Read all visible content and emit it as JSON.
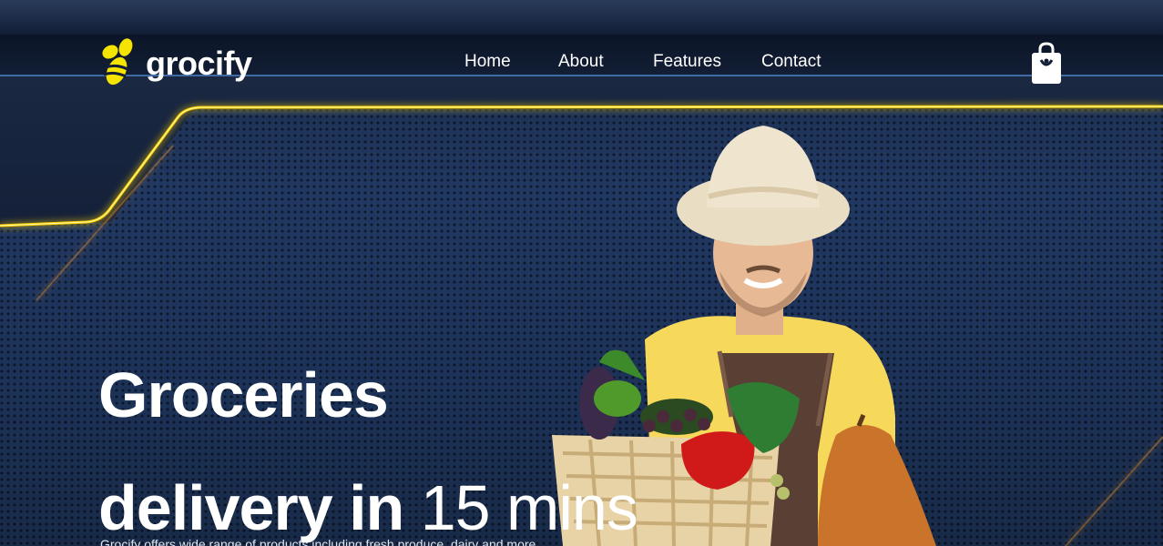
{
  "brand": {
    "name": "grocify",
    "logo_icon": "bee-icon",
    "accent_color": "#f5e400"
  },
  "nav": {
    "items": [
      {
        "label": "Home"
      },
      {
        "label": "About"
      },
      {
        "label": "Features"
      },
      {
        "label": "Contact"
      }
    ],
    "cart_icon": "shopping-bag-icon"
  },
  "hero": {
    "title_line1": "Groceries",
    "title_line2_bold": "delivery in",
    "title_line2_light": "15 mins",
    "subtitle": "Grocify offers wide range of products including fresh produce, dairy and more",
    "image": "farmer-with-vegetable-basket"
  },
  "colors": {
    "background": "#1c3258",
    "navbar": "#0c1527",
    "glow_line": "#ffd400"
  }
}
